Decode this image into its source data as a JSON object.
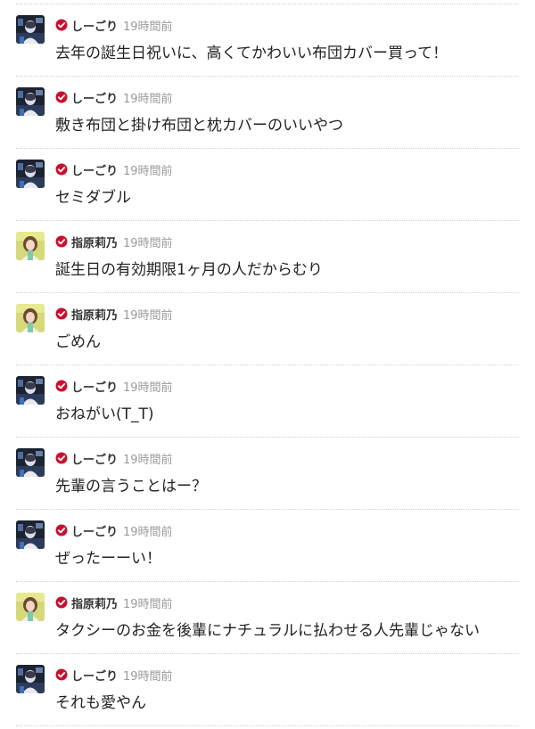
{
  "colors": {
    "verified": "#c8102e",
    "divider": "#cfcfcf",
    "timestamp": "#9a9a9a",
    "text": "#222222"
  },
  "comments": [
    {
      "author": "しーごり",
      "avatar": "shigori",
      "time": "19時間前",
      "text": "去年の誕生日祝いに、高くてかわいい布団カバー買って！"
    },
    {
      "author": "しーごり",
      "avatar": "shigori",
      "time": "19時間前",
      "text": "敷き布団と掛け布団と枕カバーのいいやつ"
    },
    {
      "author": "しーごり",
      "avatar": "shigori",
      "time": "19時間前",
      "text": "セミダブル"
    },
    {
      "author": "指原莉乃",
      "avatar": "sashihara",
      "time": "19時間前",
      "text": "誕生日の有効期限1ヶ月の人だからむり"
    },
    {
      "author": "指原莉乃",
      "avatar": "sashihara",
      "time": "19時間前",
      "text": "ごめん"
    },
    {
      "author": "しーごり",
      "avatar": "shigori",
      "time": "19時間前",
      "text": "おねがい(T_T)"
    },
    {
      "author": "しーごり",
      "avatar": "shigori",
      "time": "19時間前",
      "text": "先輩の言うことはー？"
    },
    {
      "author": "しーごり",
      "avatar": "shigori",
      "time": "19時間前",
      "text": "ぜったーーい！"
    },
    {
      "author": "指原莉乃",
      "avatar": "sashihara",
      "time": "19時間前",
      "text": "タクシーのお金を後輩にナチュラルに払わせる人先輩じゃない"
    },
    {
      "author": "しーごり",
      "avatar": "shigori",
      "time": "19時間前",
      "text": "それも愛やん"
    }
  ]
}
